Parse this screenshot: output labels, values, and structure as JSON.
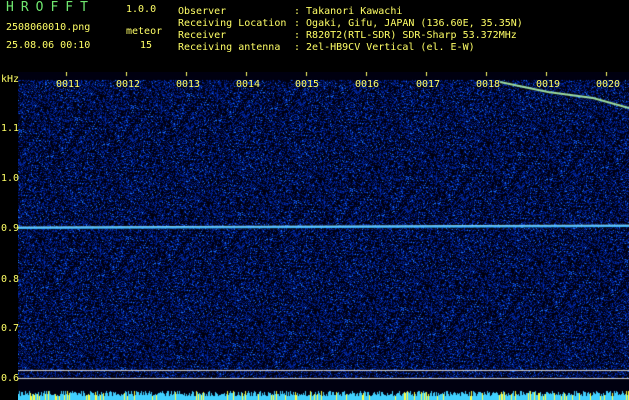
{
  "app": {
    "name": "HROFFT",
    "version": "1.0.0"
  },
  "file": {
    "name": "2508060010.png",
    "datetime": "25.08.06 00:10"
  },
  "meteor": {
    "label": "meteor",
    "count": "15"
  },
  "info": [
    {
      "key": "Observer",
      "value": ": Takanori Kawachi"
    },
    {
      "key": "Receiving Location",
      "value": ": Ogaki, Gifu, JAPAN (136.60E, 35.35N)"
    },
    {
      "key": "Receiver",
      "value": ": R820T2(RTL-SDR) SDR-Sharp 53.372MHz"
    },
    {
      "key": "Receiving antenna",
      "value": ": 2el-HB9CV Vertical (el. E-W)"
    }
  ],
  "axis": {
    "unit": "kHz",
    "y_ticks": [
      "1.1",
      "1.0",
      "0.9",
      "0.8",
      "0.7",
      "0.6"
    ],
    "x_ticks": [
      "0011",
      "0012",
      "0013",
      "0014",
      "0015",
      "0016",
      "0017",
      "0018",
      "0019",
      "0020"
    ]
  },
  "colors": {
    "header_text": "#6fe86f",
    "axis_text": "#ffff66",
    "background": "#000000"
  }
}
